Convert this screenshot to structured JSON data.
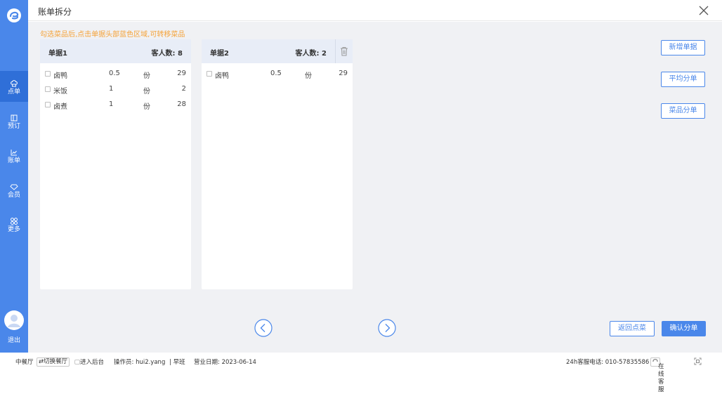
{
  "header": {
    "title": "账单拆分"
  },
  "hint": "勾选菜品后,点击单据头部蓝色区域,可转移菜品",
  "sidebar": {
    "items": [
      {
        "label": "点单"
      },
      {
        "label": "预订"
      },
      {
        "label": "账单"
      },
      {
        "label": "会员"
      },
      {
        "label": "更多"
      }
    ],
    "logout": "退出"
  },
  "bills": [
    {
      "name": "单据1",
      "guests_label": "客人数: 8",
      "items": [
        {
          "name": "卤鸭",
          "qty": "0.5",
          "unit": "份",
          "price": "29"
        },
        {
          "name": "米饭",
          "qty": "1",
          "unit": "份",
          "price": "2"
        },
        {
          "name": "卤煮",
          "qty": "1",
          "unit": "份",
          "price": "28"
        }
      ]
    },
    {
      "name": "单据2",
      "guests_label": "客人数: 2",
      "items": [
        {
          "name": "卤鸭",
          "qty": "0.5",
          "unit": "份",
          "price": "29"
        }
      ]
    }
  ],
  "actions": {
    "add_bill": "新增单据",
    "average_split": "平均分单",
    "dish_split": "菜品分单",
    "back_to_order": "返回点菜",
    "confirm_split": "确认分单"
  },
  "footer": {
    "hall": "中餐厅",
    "switch_hall": "⇄切换餐厅",
    "enter_backend": "进入后台",
    "operator": "操作员: hui2.yang",
    "shift": "| 早班",
    "business_date": "营业日期: 2023-06-14",
    "hotline": "24h客服电话: 010-57835586",
    "online_service": "在线客服"
  },
  "colors": {
    "primary": "#4a87ea",
    "hint": "#f5a33a",
    "panel_header": "#e8edf7"
  }
}
